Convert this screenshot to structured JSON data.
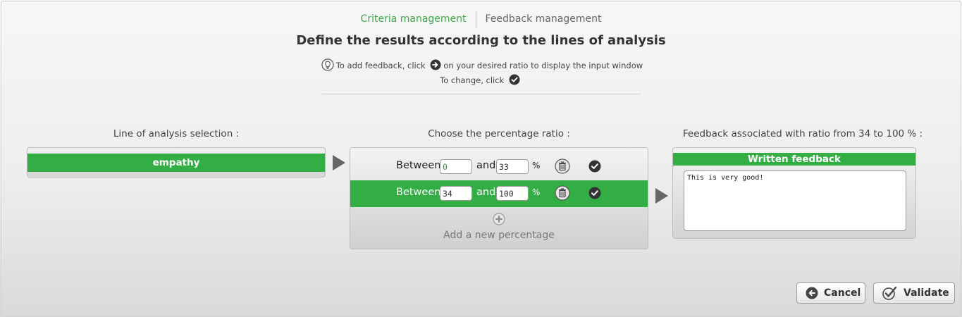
{
  "tabs": [
    {
      "label": "Criteria management",
      "active": true
    },
    {
      "label": "Feedback management",
      "active": false
    }
  ],
  "page_title": "Define the results according to the lines of analysis",
  "hints": {
    "line1_before": "To add feedback, click",
    "line1_after": "on your desired ratio to display the input window",
    "line2_before": "To change, click"
  },
  "columns": {
    "left_label": "Line of analysis selection :",
    "middle_label": "Choose the percentage ratio :",
    "right_label": "Feedback associated with ratio from 34 to 100 % :"
  },
  "lines_of_analysis": [
    {
      "label": "empathy",
      "selected": true
    }
  ],
  "ratios": [
    {
      "between_label": "Between",
      "min": "0",
      "and_label": "and",
      "max": "33",
      "percent": "%",
      "selected": false
    },
    {
      "between_label": "Between",
      "min": "34",
      "and_label": "and",
      "max": "100",
      "percent": "%",
      "selected": true
    }
  ],
  "add_percentage_label": "Add a new percentage",
  "feedback": {
    "header": "Written feedback",
    "text": "This is very good!"
  },
  "buttons": {
    "cancel": "Cancel",
    "validate": "Validate"
  },
  "colors": {
    "accent_green": "#32ae44",
    "tab_active": "#3daa4a",
    "arrow_gray": "#666666"
  },
  "icons": {
    "hint": "lightbulb-icon",
    "arrow_circle": "arrow-circle-right-icon",
    "check_circle": "check-circle-icon",
    "trash": "trash-icon",
    "add": "plus-circle-icon",
    "cancel": "back-arrow-icon",
    "validate": "checkmark-icon"
  }
}
